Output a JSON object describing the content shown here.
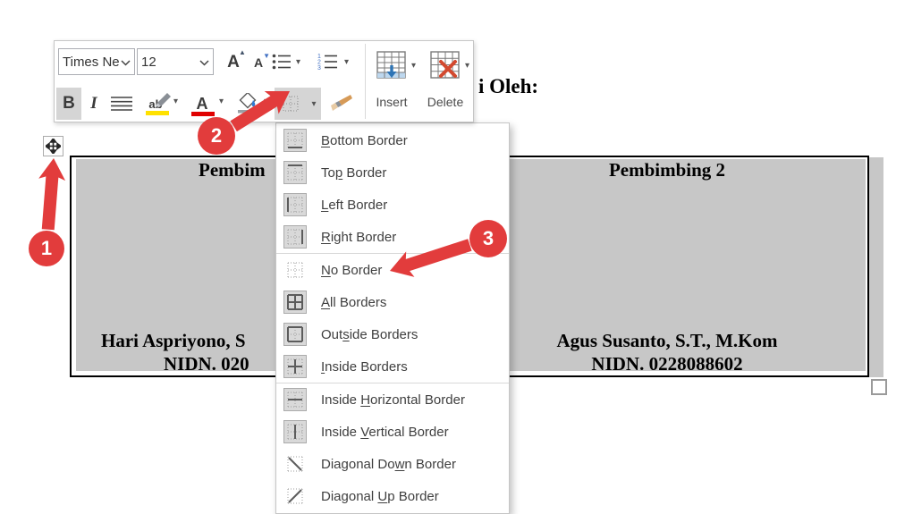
{
  "document": {
    "heading_fragment": "i Oleh:",
    "table": {
      "shading_color": "#c7c7c7",
      "left_cell": {
        "title": "Pembim",
        "line1": "Hari Aspriyono, S",
        "line2": "NIDN. 020"
      },
      "right_cell": {
        "title": "Pembimbing 2",
        "line1": "Agus Susanto, S.T., M.Kom",
        "line2": "NIDN. 0228088602"
      }
    }
  },
  "toolbar": {
    "font_name": "Times Ne",
    "font_size": "12",
    "bold_label": "B",
    "italic_label": "I",
    "highlight_label": "ab",
    "font_color_label": "A",
    "insert_label": "Insert",
    "delete_label": "Delete",
    "highlight_color": "#ffe100",
    "font_color": "#e00000"
  },
  "menu": {
    "items": [
      {
        "pre": "",
        "key": "B",
        "post": "ottom Border",
        "icon": "border-bottom-icon",
        "boxed": true,
        "separator_before": false
      },
      {
        "pre": "To",
        "key": "p",
        "post": " Border",
        "icon": "border-top-icon",
        "boxed": true,
        "separator_before": false
      },
      {
        "pre": "",
        "key": "L",
        "post": "eft Border",
        "icon": "border-left-icon",
        "boxed": true,
        "separator_before": false
      },
      {
        "pre": "",
        "key": "R",
        "post": "ight Border",
        "icon": "border-right-icon",
        "boxed": true,
        "separator_before": false
      },
      {
        "pre": "",
        "key": "N",
        "post": "o Border",
        "icon": "border-none-icon",
        "boxed": false,
        "separator_before": true
      },
      {
        "pre": "",
        "key": "A",
        "post": "ll Borders",
        "icon": "border-all-icon",
        "boxed": true,
        "separator_before": false
      },
      {
        "pre": "Out",
        "key": "s",
        "post": "ide Borders",
        "icon": "border-outside-icon",
        "boxed": true,
        "separator_before": false
      },
      {
        "pre": "",
        "key": "I",
        "post": "nside Borders",
        "icon": "border-inside-icon",
        "boxed": true,
        "separator_before": false
      },
      {
        "pre": "Inside ",
        "key": "H",
        "post": "orizontal Border",
        "icon": "border-inside-h-icon",
        "boxed": true,
        "separator_before": true
      },
      {
        "pre": "Inside ",
        "key": "V",
        "post": "ertical Border",
        "icon": "border-inside-v-icon",
        "boxed": true,
        "separator_before": false
      },
      {
        "pre": "Diagonal Do",
        "key": "w",
        "post": "n Border",
        "icon": "border-diag-down-icon",
        "boxed": false,
        "separator_before": false
      },
      {
        "pre": "Diagonal ",
        "key": "U",
        "post": "p Border",
        "icon": "border-diag-up-icon",
        "boxed": false,
        "separator_before": false
      }
    ]
  },
  "callouts": {
    "color": "#e23c3c",
    "step1": "1",
    "step2": "2",
    "step3": "3"
  }
}
